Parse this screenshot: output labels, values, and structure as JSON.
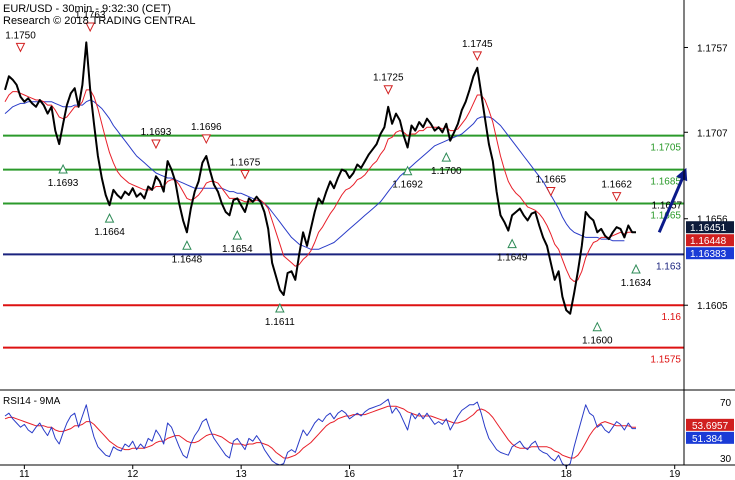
{
  "header": {
    "line1": "EUR/USD - 30min - 9:32:30 (CET)",
    "line2": "Research © 2018 TRADING CENTRAL"
  },
  "colors": {
    "price": "#000000",
    "ma_red": "#e8202a",
    "ma_blue": "#2a3cc8",
    "level_green": "#2b9a2b",
    "pivot_blue": "#1a237e",
    "support_red": "#dd1111",
    "arrow": "#0b1a8a",
    "up_marker": "#2e8b57",
    "down_marker": "#d22222",
    "badge_current": "#0d1b3a",
    "badge_red": "#d01f1f",
    "badge_blue": "#1a3bd6"
  },
  "chart_data": [
    {
      "type": "line",
      "title": "EUR/USD - 30min",
      "ylim": [
        1.1555,
        1.1785
      ],
      "yticks": [
        1.1605,
        1.1656,
        1.1707,
        1.1757
      ],
      "ytick_labels": [
        "1.1605",
        "1.1656",
        "1.1707",
        "1.1757"
      ],
      "xticks": [
        {
          "i": 5,
          "label": "11"
        },
        {
          "i": 33,
          "label": "12"
        },
        {
          "i": 61,
          "label": "13"
        },
        {
          "i": 89,
          "label": "16"
        },
        {
          "i": 117,
          "label": "17"
        },
        {
          "i": 145,
          "label": "18"
        },
        {
          "i": 173,
          "label": "19"
        }
      ],
      "price": [
        1.1732,
        1.174,
        1.1738,
        1.1735,
        1.1728,
        1.1725,
        1.1727,
        1.1724,
        1.1722,
        1.1726,
        1.1723,
        1.1718,
        1.1722,
        1.1708,
        1.17,
        1.1712,
        1.1723,
        1.173,
        1.1733,
        1.1722,
        1.1735,
        1.176,
        1.1732,
        1.1712,
        1.1693,
        1.168,
        1.167,
        1.1664,
        1.1673,
        1.167,
        1.1668,
        1.1672,
        1.167,
        1.1674,
        1.1669,
        1.1671,
        1.1668,
        1.1675,
        1.1673,
        1.1681,
        1.1678,
        1.1672,
        1.169,
        1.1685,
        1.1678,
        1.1665,
        1.1655,
        1.1648,
        1.1662,
        1.1672,
        1.1678,
        1.1689,
        1.1693,
        1.1684,
        1.1676,
        1.1672,
        1.1665,
        1.166,
        1.1658,
        1.1667,
        1.1668,
        1.1664,
        1.166,
        1.1668,
        1.1666,
        1.1669,
        1.1666,
        1.166,
        1.165,
        1.163,
        1.1622,
        1.1614,
        1.1611,
        1.1624,
        1.1625,
        1.162,
        1.1635,
        1.1648,
        1.164,
        1.165,
        1.166,
        1.1668,
        1.1665,
        1.1672,
        1.1678,
        1.1674,
        1.168,
        1.1685,
        1.1684,
        1.168,
        1.1683,
        1.1688,
        1.1686,
        1.169,
        1.1694,
        1.1697,
        1.17,
        1.1706,
        1.171,
        1.1722,
        1.1712,
        1.1718,
        1.1714,
        1.1705,
        1.1698,
        1.1711,
        1.1708,
        1.1713,
        1.171,
        1.1715,
        1.1712,
        1.1708,
        1.171,
        1.1707,
        1.1712,
        1.1702,
        1.1707,
        1.1712,
        1.172,
        1.1725,
        1.1732,
        1.174,
        1.1745,
        1.173,
        1.1715,
        1.17,
        1.169,
        1.1672,
        1.1658,
        1.1654,
        1.1649,
        1.1658,
        1.166,
        1.1662,
        1.1658,
        1.1655,
        1.1659,
        1.166,
        1.1652,
        1.1645,
        1.164,
        1.163,
        1.162,
        1.1625,
        1.161,
        1.1602,
        1.16,
        1.1612,
        1.1625,
        1.164,
        1.166,
        1.1657,
        1.1655,
        1.1648,
        1.165,
        1.1646,
        1.1644,
        1.1648,
        1.1651,
        1.165,
        1.1645,
        1.1652,
        1.1648,
        1.1648
      ],
      "ma_red": [
        1.1725,
        1.1729,
        1.1731,
        1.1731,
        1.173,
        1.1729,
        1.1728,
        1.1727,
        1.1726,
        1.1726,
        1.1725,
        1.1723,
        1.1723,
        1.172,
        1.1716,
        1.1715,
        1.1716,
        1.1719,
        1.1722,
        1.1722,
        1.1725,
        1.1732,
        1.1732,
        1.1728,
        1.1721,
        1.1712,
        1.1703,
        1.1695,
        1.1689,
        1.1684,
        1.1681,
        1.1679,
        1.1677,
        1.1676,
        1.1675,
        1.1674,
        1.1673,
        1.1673,
        1.1673,
        1.1675,
        1.1675,
        1.1675,
        1.1678,
        1.1679,
        1.1679,
        1.1676,
        1.1672,
        1.1668,
        1.1667,
        1.1668,
        1.167,
        1.1673,
        1.1677,
        1.1678,
        1.1678,
        1.1677,
        1.1674,
        1.1671,
        1.1668,
        1.1668,
        1.1668,
        1.1667,
        1.1666,
        1.1666,
        1.1666,
        1.1667,
        1.1667,
        1.1665,
        1.1662,
        1.1655,
        1.1648,
        1.1641,
        1.1634,
        1.1632,
        1.163,
        1.1628,
        1.1629,
        1.1632,
        1.1634,
        1.1637,
        1.1642,
        1.1648,
        1.1651,
        1.1655,
        1.1659,
        1.1662,
        1.1666,
        1.167,
        1.1673,
        1.1674,
        1.1676,
        1.1679,
        1.168,
        1.1682,
        1.1685,
        1.1688,
        1.169,
        1.1694,
        1.1697,
        1.1703,
        1.1704,
        1.1707,
        1.1708,
        1.1707,
        1.1705,
        1.1706,
        1.1706,
        1.1708,
        1.1708,
        1.171,
        1.171,
        1.171,
        1.171,
        1.1709,
        1.171,
        1.1708,
        1.1708,
        1.1709,
        1.1712,
        1.1715,
        1.1719,
        1.1724,
        1.1729,
        1.1729,
        1.1726,
        1.172,
        1.1713,
        1.1703,
        1.1693,
        1.1685,
        1.1678,
        1.1674,
        1.1671,
        1.1669,
        1.1666,
        1.1663,
        1.1662,
        1.1661,
        1.1659,
        1.1656,
        1.1652,
        1.1647,
        1.1641,
        1.1638,
        1.1632,
        1.1626,
        1.1621,
        1.1619,
        1.162,
        1.1625,
        1.1633,
        1.1638,
        1.1642,
        1.1643,
        1.1645,
        1.1645,
        1.1645,
        1.1646,
        1.1647,
        1.1648,
        1.1647,
        1.1648,
        1.1648,
        1.1648
      ],
      "ma_blue": [
        1.1718,
        1.172,
        1.1722,
        1.1723,
        1.1724,
        1.1724,
        1.1725,
        1.1725,
        1.1725,
        1.1725,
        1.1725,
        1.1725,
        1.1725,
        1.1724,
        1.1723,
        1.1722,
        1.1722,
        1.1722,
        1.1723,
        1.1723,
        1.1723,
        1.1725,
        1.1726,
        1.1725,
        1.1723,
        1.1721,
        1.1718,
        1.1715,
        1.1711,
        1.1708,
        1.1705,
        1.1702,
        1.1699,
        1.1696,
        1.1693,
        1.1691,
        1.1689,
        1.1687,
        1.1685,
        1.1683,
        1.1682,
        1.1681,
        1.168,
        1.168,
        1.1679,
        1.1678,
        1.1677,
        1.1676,
        1.1675,
        1.1674,
        1.1674,
        1.1674,
        1.1674,
        1.1674,
        1.1674,
        1.1674,
        1.1674,
        1.1673,
        1.1672,
        1.1672,
        1.1671,
        1.1671,
        1.167,
        1.1669,
        1.1668,
        1.1667,
        1.1666,
        1.1665,
        1.1663,
        1.166,
        1.1657,
        1.1654,
        1.1651,
        1.1648,
        1.1645,
        1.1643,
        1.1641,
        1.164,
        1.1639,
        1.1638,
        1.1638,
        1.1638,
        1.1639,
        1.164,
        1.1641,
        1.1642,
        1.1644,
        1.1646,
        1.1648,
        1.165,
        1.1652,
        1.1654,
        1.1656,
        1.1658,
        1.166,
        1.1662,
        1.1664,
        1.1666,
        1.1669,
        1.1672,
        1.1675,
        1.1678,
        1.1681,
        1.1683,
        1.1685,
        1.1687,
        1.1689,
        1.1691,
        1.1693,
        1.1695,
        1.1697,
        1.1699,
        1.17,
        1.1701,
        1.1702,
        1.1703,
        1.1704,
        1.1705,
        1.1706,
        1.1708,
        1.171,
        1.1712,
        1.1715,
        1.1716,
        1.1716,
        1.1716,
        1.1715,
        1.1713,
        1.1711,
        1.1708,
        1.1705,
        1.1702,
        1.1699,
        1.1696,
        1.1693,
        1.169,
        1.1687,
        1.1684,
        1.1681,
        1.1678,
        1.1674,
        1.167,
        1.1666,
        1.1662,
        1.1657,
        1.1653,
        1.165,
        1.1648,
        1.1647,
        1.1646,
        1.1645,
        1.1645,
        1.1645,
        1.1645,
        1.1644,
        1.1644,
        1.1644,
        1.1643,
        1.1643,
        1.1643,
        1.1643
      ],
      "levels": [
        {
          "value": 1.1705,
          "label": "1.1705",
          "kind": "green"
        },
        {
          "value": 1.1685,
          "label": "1.1685",
          "kind": "green"
        },
        {
          "value": 1.1665,
          "label": "1.1665",
          "kind": "green"
        },
        {
          "value": 1.1635,
          "label": "1.163",
          "kind": "pivot"
        },
        {
          "value": 1.1605,
          "label": "1.16",
          "kind": "red"
        },
        {
          "value": 1.158,
          "label": "1.1575",
          "kind": "red"
        }
      ],
      "markers": [
        {
          "i": 4,
          "value": 1.175,
          "dir": "down",
          "label": "1.1750",
          "label_pos": "above"
        },
        {
          "i": 15,
          "value": 1.1693,
          "dir": "up",
          "label": "1.1693",
          "label_pos": "below"
        },
        {
          "i": 22,
          "value": 1.1762,
          "dir": "down",
          "label": "1.1763",
          "label_pos": "above"
        },
        {
          "i": 27,
          "value": 1.1664,
          "dir": "up",
          "label": "1.1664",
          "label_pos": "below"
        },
        {
          "i": 39,
          "value": 1.1693,
          "dir": "down",
          "label": "1.1693",
          "label_pos": "above"
        },
        {
          "i": 47,
          "value": 1.1648,
          "dir": "up",
          "label": "1.1648",
          "label_pos": "below"
        },
        {
          "i": 52,
          "value": 1.1696,
          "dir": "down",
          "label": "1.1696",
          "label_pos": "above"
        },
        {
          "i": 60,
          "value": 1.1654,
          "dir": "up",
          "label": "1.1654",
          "label_pos": "below"
        },
        {
          "i": 62,
          "value": 1.1675,
          "dir": "down",
          "label": "1.1675",
          "label_pos": "above"
        },
        {
          "i": 71,
          "value": 1.1611,
          "dir": "up",
          "label": "1.1611",
          "label_pos": "below"
        },
        {
          "i": 99,
          "value": 1.1725,
          "dir": "down",
          "label": "1.1725",
          "label_pos": "above"
        },
        {
          "i": 104,
          "value": 1.1692,
          "dir": "up",
          "label": "1.1692",
          "label_pos": "below"
        },
        {
          "i": 114,
          "value": 1.17,
          "dir": "up",
          "label": "1.1700",
          "label_pos": "below"
        },
        {
          "i": 122,
          "value": 1.1745,
          "dir": "down",
          "label": "1.1745",
          "label_pos": "above"
        },
        {
          "i": 131,
          "value": 1.1649,
          "dir": "up",
          "label": "1.1649",
          "label_pos": "below"
        },
        {
          "i": 141,
          "value": 1.1665,
          "dir": "down",
          "label": "1.1665",
          "label_pos": "above"
        },
        {
          "i": 153,
          "value": 1.16,
          "dir": "up",
          "label": "1.1600",
          "label_pos": "below"
        },
        {
          "i": 158,
          "value": 1.1662,
          "dir": "down",
          "label": "1.1662",
          "label_pos": "above"
        },
        {
          "i": 163,
          "value": 1.1634,
          "dir": "up",
          "label": "1.1634",
          "label_pos": "below"
        }
      ],
      "annotations": [
        {
          "i": 167,
          "value": 1.1661,
          "label": "1.1657"
        }
      ],
      "forecast_arrow": {
        "from_i": 169,
        "from_value": 1.1648,
        "to_i": 176,
        "to_value": 1.1686
      },
      "badges": [
        {
          "value": 1.1651,
          "label": "1.16451",
          "kind": "current"
        },
        {
          "value": 1.1646,
          "label": "1.16448",
          "kind": "red"
        },
        {
          "value": 1.1641,
          "label": "1.16383",
          "kind": "blue"
        }
      ]
    },
    {
      "type": "line",
      "title": "RSI14 - 9MA",
      "ylim": [
        25,
        75
      ],
      "yticks": [
        70,
        30
      ],
      "ytick_labels": [
        "70",
        "30"
      ],
      "rsi": [
        60,
        62,
        58,
        55,
        52,
        54,
        50,
        48,
        52,
        55,
        50,
        46,
        52,
        44,
        40,
        48,
        55,
        60,
        62,
        52,
        60,
        68,
        55,
        45,
        38,
        35,
        32,
        31,
        38,
        36,
        35,
        40,
        38,
        42,
        36,
        40,
        37,
        44,
        42,
        50,
        46,
        40,
        55,
        52,
        45,
        38,
        32,
        30,
        40,
        46,
        50,
        56,
        58,
        50,
        44,
        40,
        36,
        32,
        30,
        42,
        44,
        40,
        36,
        44,
        42,
        46,
        42,
        36,
        32,
        28,
        26,
        25,
        26,
        34,
        36,
        34,
        42,
        50,
        46,
        50,
        55,
        58,
        56,
        60,
        62,
        58,
        62,
        64,
        62,
        58,
        60,
        62,
        60,
        63,
        65,
        66,
        67,
        68,
        70,
        72,
        62,
        66,
        62,
        56,
        50,
        62,
        58,
        62,
        58,
        62,
        58,
        54,
        56,
        54,
        58,
        50,
        55,
        60,
        64,
        66,
        68,
        68,
        70,
        62,
        52,
        44,
        40,
        36,
        34,
        33,
        32,
        38,
        40,
        42,
        38,
        36,
        40,
        42,
        36,
        34,
        33,
        30,
        28,
        32,
        26,
        24,
        26,
        38,
        48,
        58,
        68,
        62,
        60,
        52,
        54,
        50,
        48,
        52,
        56,
        54,
        50,
        55,
        51,
        51
      ],
      "ma9": [
        58,
        59,
        59,
        58,
        57,
        56,
        55,
        54,
        53,
        53,
        53,
        52,
        52,
        50,
        49,
        49,
        50,
        51,
        53,
        53,
        54,
        56,
        56,
        54,
        51,
        48,
        45,
        42,
        40,
        38,
        37,
        36,
        36,
        37,
        37,
        37,
        37,
        38,
        39,
        41,
        42,
        42,
        44,
        45,
        46,
        46,
        44,
        42,
        41,
        41,
        42,
        44,
        46,
        47,
        47,
        46,
        45,
        43,
        41,
        40,
        40,
        40,
        39,
        40,
        40,
        41,
        41,
        40,
        39,
        37,
        34,
        32,
        30,
        30,
        31,
        32,
        34,
        37,
        39,
        41,
        44,
        47,
        50,
        53,
        55,
        56,
        58,
        59,
        60,
        60,
        61,
        61,
        61,
        61,
        62,
        63,
        64,
        65,
        66,
        67,
        67,
        67,
        66,
        65,
        63,
        62,
        61,
        60,
        60,
        60,
        60,
        59,
        58,
        57,
        57,
        56,
        55,
        55,
        56,
        57,
        59,
        61,
        64,
        65,
        64,
        62,
        59,
        55,
        51,
        47,
        43,
        40,
        38,
        37,
        37,
        37,
        38,
        38,
        38,
        38,
        38,
        37,
        35,
        34,
        32,
        31,
        30,
        30,
        32,
        36,
        41,
        46,
        50,
        53,
        55,
        56,
        55,
        54,
        53,
        53,
        53,
        53,
        52,
        52
      ],
      "badges": [
        {
          "value": 53.6957,
          "label": "53.6957",
          "kind": "red"
        },
        {
          "value": 51.384,
          "label": "51.384",
          "kind": "blue"
        }
      ]
    }
  ]
}
